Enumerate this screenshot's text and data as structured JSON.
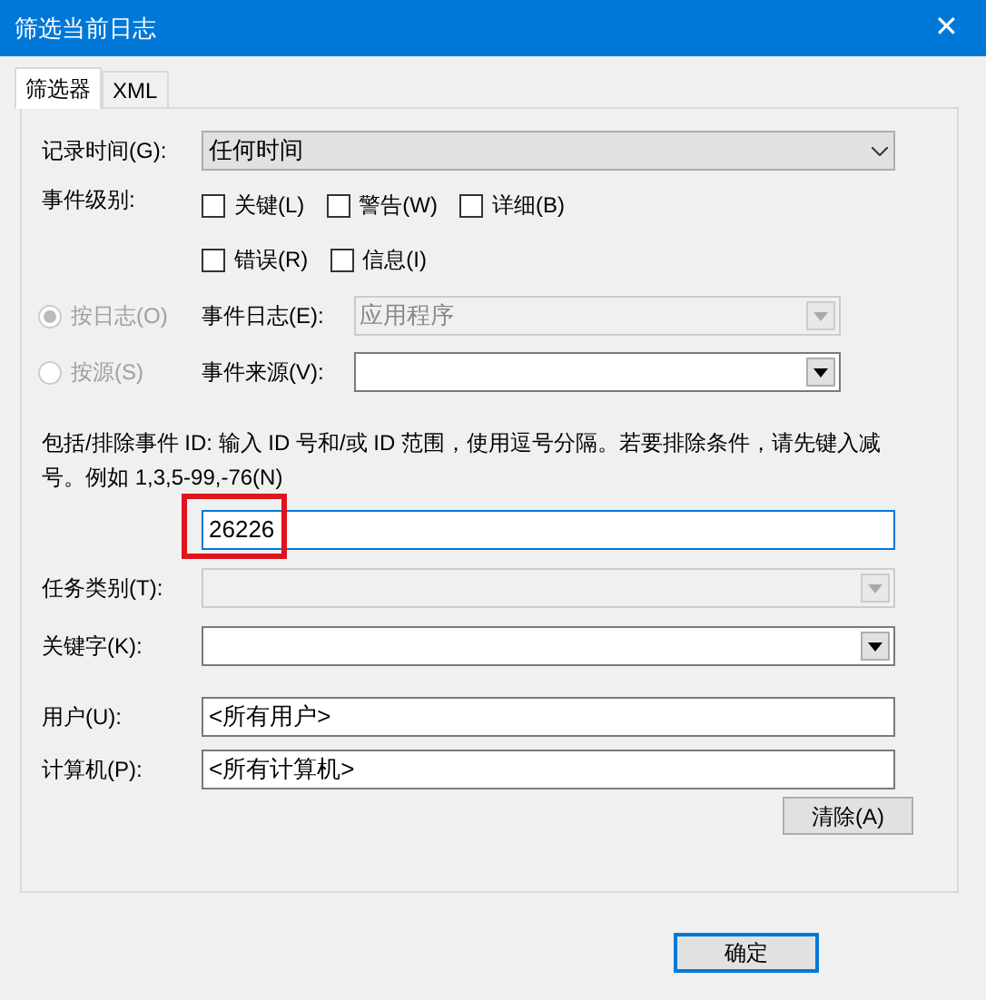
{
  "window": {
    "title": "筛选当前日志",
    "close": "✕"
  },
  "tabs": [
    {
      "label": "筛选器",
      "selected": true
    },
    {
      "label": "XML",
      "selected": false
    }
  ],
  "logged": {
    "label": "记录时间(G):",
    "value": "任何时间"
  },
  "levels": {
    "label": "事件级别:",
    "items": [
      {
        "label": "关键(L)",
        "checked": false
      },
      {
        "label": "警告(W)",
        "checked": false
      },
      {
        "label": "详细(B)",
        "checked": false
      },
      {
        "label": "错误(R)",
        "checked": false
      },
      {
        "label": "信息(I)",
        "checked": false
      }
    ]
  },
  "sources": [
    {
      "option": "按日志(O)",
      "selected": true,
      "disabled": true,
      "label": "事件日志(E):",
      "value": "应用程序",
      "field_disabled": true
    },
    {
      "option": "按源(S)",
      "selected": false,
      "disabled": true,
      "label": "事件来源(V):",
      "field_disabled": false
    }
  ],
  "event_id": {
    "description": "包括/排除事件 ID: 输入 ID 号和/或 ID 范围，使用逗号分隔。若要排除条件，请先键入减号。例如 1,3,5-99,-76(N)",
    "value": "26226",
    "highlighted": true
  },
  "task_category": {
    "label": "任务类别(T):",
    "disabled": true
  },
  "keywords": {
    "label": "关键字(K):",
    "disabled": false
  },
  "user": {
    "label": "用户(U):",
    "value": "<所有用户>"
  },
  "computer": {
    "label": "计算机(P):",
    "value": "<所有计算机>"
  },
  "clear_button": "清除(A)",
  "ok_button": "确定"
}
